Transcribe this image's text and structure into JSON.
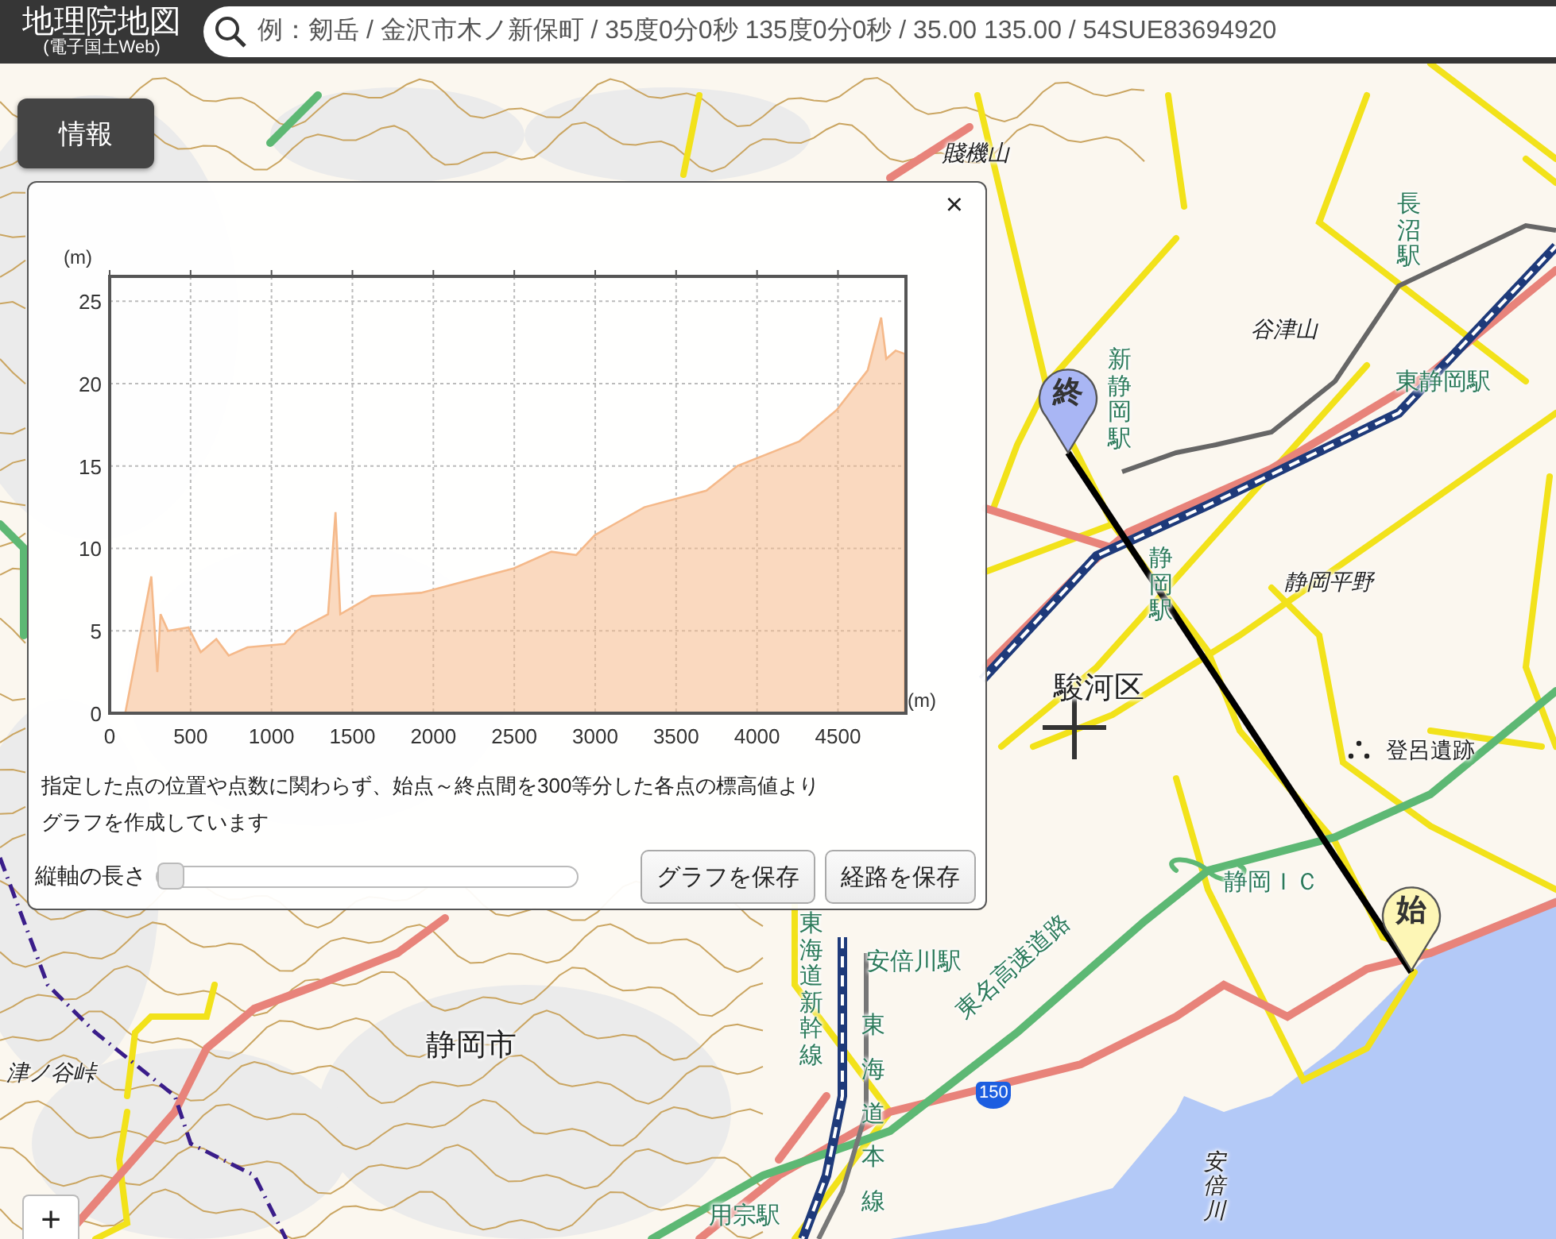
{
  "header": {
    "logo_title": "地理院地図",
    "logo_subtitle": "(電子国土Web)",
    "search": {
      "placeholder": "例：剱岳 / 金沢市木ノ新保町 / 35度0分0秒 135度0分0秒 / 35.00 135.00 / 54SUE83694920"
    }
  },
  "info_button": "情報",
  "profile_panel": {
    "close": "×",
    "chart_data": {
      "type": "area",
      "xlabel": "(m)",
      "ylabel": "(m)",
      "x": [
        96,
        257,
        295,
        314,
        360,
        487,
        563,
        659,
        736,
        851,
        1081,
        1157,
        1349,
        1395,
        1425,
        1617,
        1924,
        2077,
        2498,
        2729,
        2882,
        2997,
        3304,
        3687,
        3879,
        4262,
        4492,
        4683,
        4767,
        4798,
        4856,
        4913
      ],
      "series": [
        {
          "color": "#f5b98a",
          "values": [
            0,
            8.3,
            2.5,
            6,
            5,
            5.2,
            3.7,
            4.5,
            3.5,
            4,
            4.2,
            5,
            6,
            12.2,
            6,
            7.1,
            7.3,
            7.7,
            8.8,
            9.8,
            9.6,
            10.8,
            12.5,
            13.5,
            15,
            16.5,
            18.4,
            20.8,
            24,
            21.5,
            22,
            21.8
          ]
        }
      ],
      "xlim": [
        0,
        4920
      ],
      "ylim": [
        0,
        26.5
      ],
      "xticks": [
        0,
        500,
        1000,
        1500,
        2000,
        2500,
        3000,
        3500,
        4000,
        4500
      ],
      "yticks": [
        0,
        5,
        10,
        15,
        20,
        25
      ],
      "grid": true
    },
    "note": "指定した点の位置や点数に関わらず、始点～終点間を300等分した各点の標高値よりグラフを作成しています",
    "axis_length": {
      "label": "縦軸の長さ",
      "level": 0
    },
    "buttons": [
      "グラフを保存",
      "経路を保存"
    ]
  },
  "map": {
    "labels": [
      {
        "text": "賤機山",
        "kind": "landform"
      },
      {
        "text": "長沼駅",
        "kind": "station"
      },
      {
        "text": "谷津山",
        "kind": "landform"
      },
      {
        "text": "新静岡駅",
        "kind": "station"
      },
      {
        "text": "東静岡駅",
        "kind": "station"
      },
      {
        "text": "静岡駅",
        "kind": "station"
      },
      {
        "text": "静岡平野",
        "kind": "landform"
      },
      {
        "text": "駿河区",
        "kind": "district"
      },
      {
        "text": "登呂遺跡",
        "kind": "site"
      },
      {
        "text": "静岡ＩＣ",
        "kind": "station"
      },
      {
        "text": "東名高速道路",
        "kind": "station"
      },
      {
        "text": "安倍川駅",
        "kind": "station"
      },
      {
        "text": "東海道新幹線",
        "kind": "station"
      },
      {
        "text": "東海道本線",
        "kind": "station"
      },
      {
        "text": "安倍川",
        "kind": "landform"
      },
      {
        "text": "静岡市",
        "kind": "district"
      },
      {
        "text": "津ノ谷峠",
        "kind": "landform"
      },
      {
        "text": "用宗駅",
        "kind": "station"
      }
    ],
    "markers": [
      {
        "text": "終",
        "kind": "end"
      },
      {
        "text": "始",
        "kind": "start"
      }
    ],
    "route_sign": "150",
    "zoom_in": "+"
  }
}
